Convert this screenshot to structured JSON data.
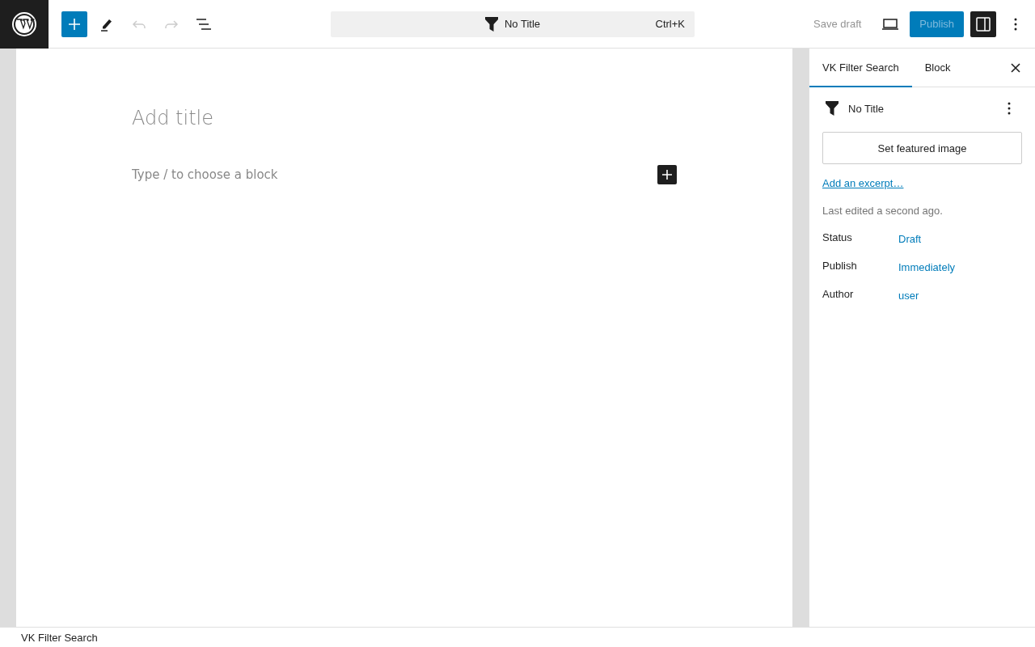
{
  "toolbar": {
    "undo_disabled": true,
    "redo_disabled": true
  },
  "command_bar": {
    "title": "No Title",
    "shortcut": "Ctrl+K"
  },
  "actions": {
    "save_draft": "Save draft",
    "publish": "Publish",
    "publish_disabled": true,
    "settings_pressed": true
  },
  "editor": {
    "title_placeholder": "Add title",
    "block_placeholder": "Type / to choose a block"
  },
  "sidebar": {
    "tabs": [
      {
        "label": "VK Filter Search",
        "selected": true
      },
      {
        "label": "Block",
        "selected": false
      }
    ],
    "post_title": "No Title",
    "featured_image_button": "Set featured image",
    "excerpt_link": "Add an excerpt…",
    "last_edited": "Last edited a second ago.",
    "rows": [
      {
        "label": "Status",
        "value": "Draft"
      },
      {
        "label": "Publish",
        "value": "Immediately"
      },
      {
        "label": "Author",
        "value": "user"
      }
    ]
  },
  "footer": {
    "breadcrumb": "VK Filter Search"
  }
}
